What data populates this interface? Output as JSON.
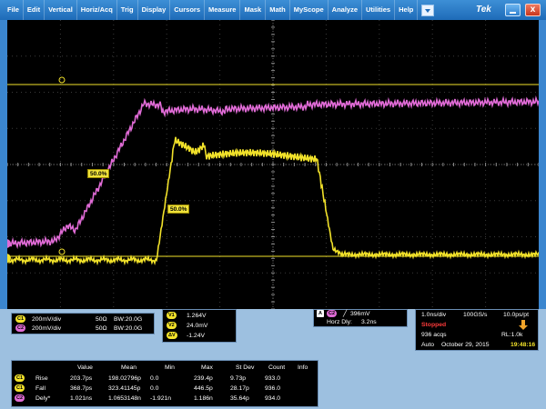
{
  "menubar": {
    "items": [
      "File",
      "Edit",
      "Vertical",
      "Horiz/Acq",
      "Trig",
      "Display",
      "Cursors",
      "Measure",
      "Mask",
      "Math",
      "MyScope",
      "Analyze",
      "Utilities",
      "Help"
    ],
    "brand": "Tek",
    "close_label": "x"
  },
  "scope": {
    "ref_label_a": "50.0%",
    "ref_label_b": "50.0%",
    "channel1_color": "#f2e22a",
    "channel2_color": "#e06bd6",
    "cursor_color": "#f2e22a"
  },
  "channels": {
    "ch1": {
      "badge": "C1",
      "scale": "200mV/div",
      "impedance": "50Ω",
      "bw": "BW:20.0G"
    },
    "ch2": {
      "badge": "C2",
      "scale": "200mV/div",
      "impedance": "50Ω",
      "bw": "BW:20.0G"
    }
  },
  "cursor_readout": {
    "v1_label": "V1",
    "v1": "1.264V",
    "v2_label": "V2",
    "v2": "24.0mV",
    "dv_label": "ΔV",
    "dv": "-1.24V"
  },
  "trigger": {
    "badge": "A",
    "channel_badge": "C2",
    "level": "396mV",
    "horz_dly_label": "Horz Dly:",
    "horz_dly": "3.2ns"
  },
  "acquisition": {
    "timebase": "1.0ns/div",
    "sample_rate": "100GS/s",
    "resolution": "10.0ps/pt",
    "state": "Stopped",
    "acqs": "936 acqs",
    "record_length": "RL:1.0k",
    "mode": "Auto",
    "date": "October 29, 2015",
    "time": "19:48:16"
  },
  "measurements": {
    "headers": [
      "Value",
      "Mean",
      "Min",
      "Max",
      "St Dev",
      "Count",
      "Info"
    ],
    "rows": [
      {
        "badge": "C1",
        "name": "Rise",
        "value": "203.7ps",
        "mean": "198.02796p",
        "min": "0.0",
        "max": "239.4p",
        "stdev": "9.73p",
        "count": "933.0",
        "info": ""
      },
      {
        "badge": "C1",
        "name": "Fall",
        "value": "368.7ps",
        "mean": "323.41145p",
        "min": "0.0",
        "max": "446.5p",
        "stdev": "28.17p",
        "count": "936.0",
        "info": ""
      },
      {
        "badge": "C2",
        "name": "Dely*",
        "value": "1.021ns",
        "mean": "1.0653148n",
        "min": "-1.921n",
        "max": "1.186n",
        "stdev": "35.64p",
        "count": "934.0",
        "info": ""
      }
    ]
  }
}
